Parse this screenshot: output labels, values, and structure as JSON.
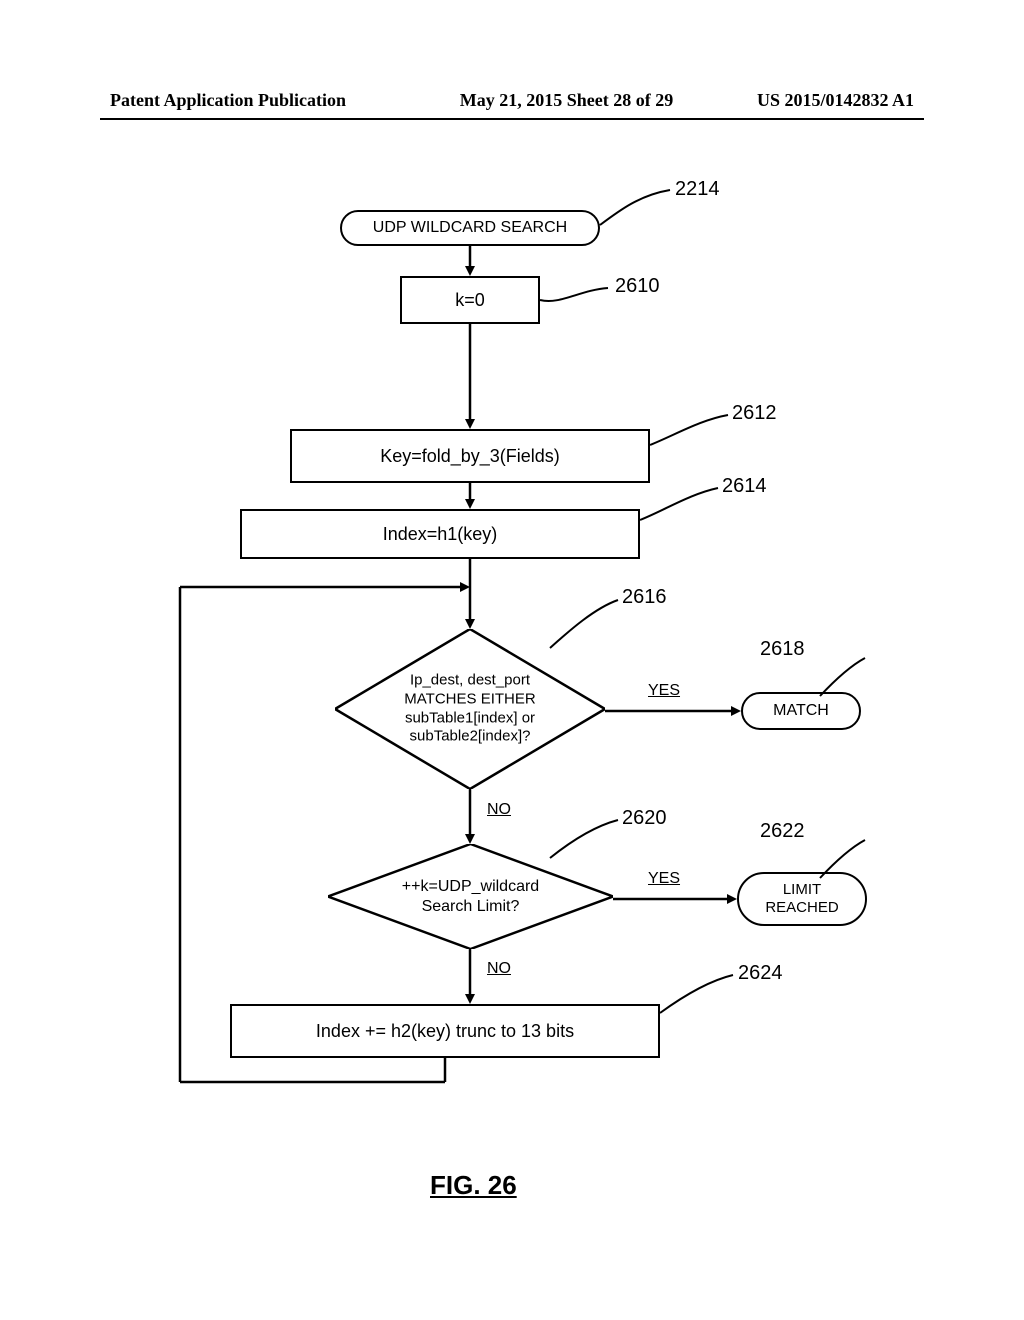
{
  "header": {
    "left": "Patent Application Publication",
    "center": "May 21, 2015  Sheet 28 of 29",
    "right": "US 2015/0142832 A1"
  },
  "figure_title": "FIG. 26",
  "nodes": {
    "start": "UDP WILDCARD SEARCH",
    "init": "k=0",
    "fold": "Key=fold_by_3(Fields)",
    "index": "Index=h1(key)",
    "decision1": "Ip_dest, dest_port\nMATCHES EITHER\nsubTable1[index] or\nsubTable2[index]?",
    "match": "MATCH",
    "decision2": "++k=UDP_wildcard\nSearch Limit?",
    "limit": "LIMIT\nREACHED",
    "rehash": "Index += h2(key) trunc to 13 bits"
  },
  "flow_labels": {
    "yes1": "YES",
    "no1": "NO",
    "yes2": "YES",
    "no2": "NO"
  },
  "refs": {
    "r2214": "2214",
    "r2610": "2610",
    "r2612": "2612",
    "r2614": "2614",
    "r2616": "2616",
    "r2618": "2618",
    "r2620": "2620",
    "r2622": "2622",
    "r2624": "2624"
  }
}
